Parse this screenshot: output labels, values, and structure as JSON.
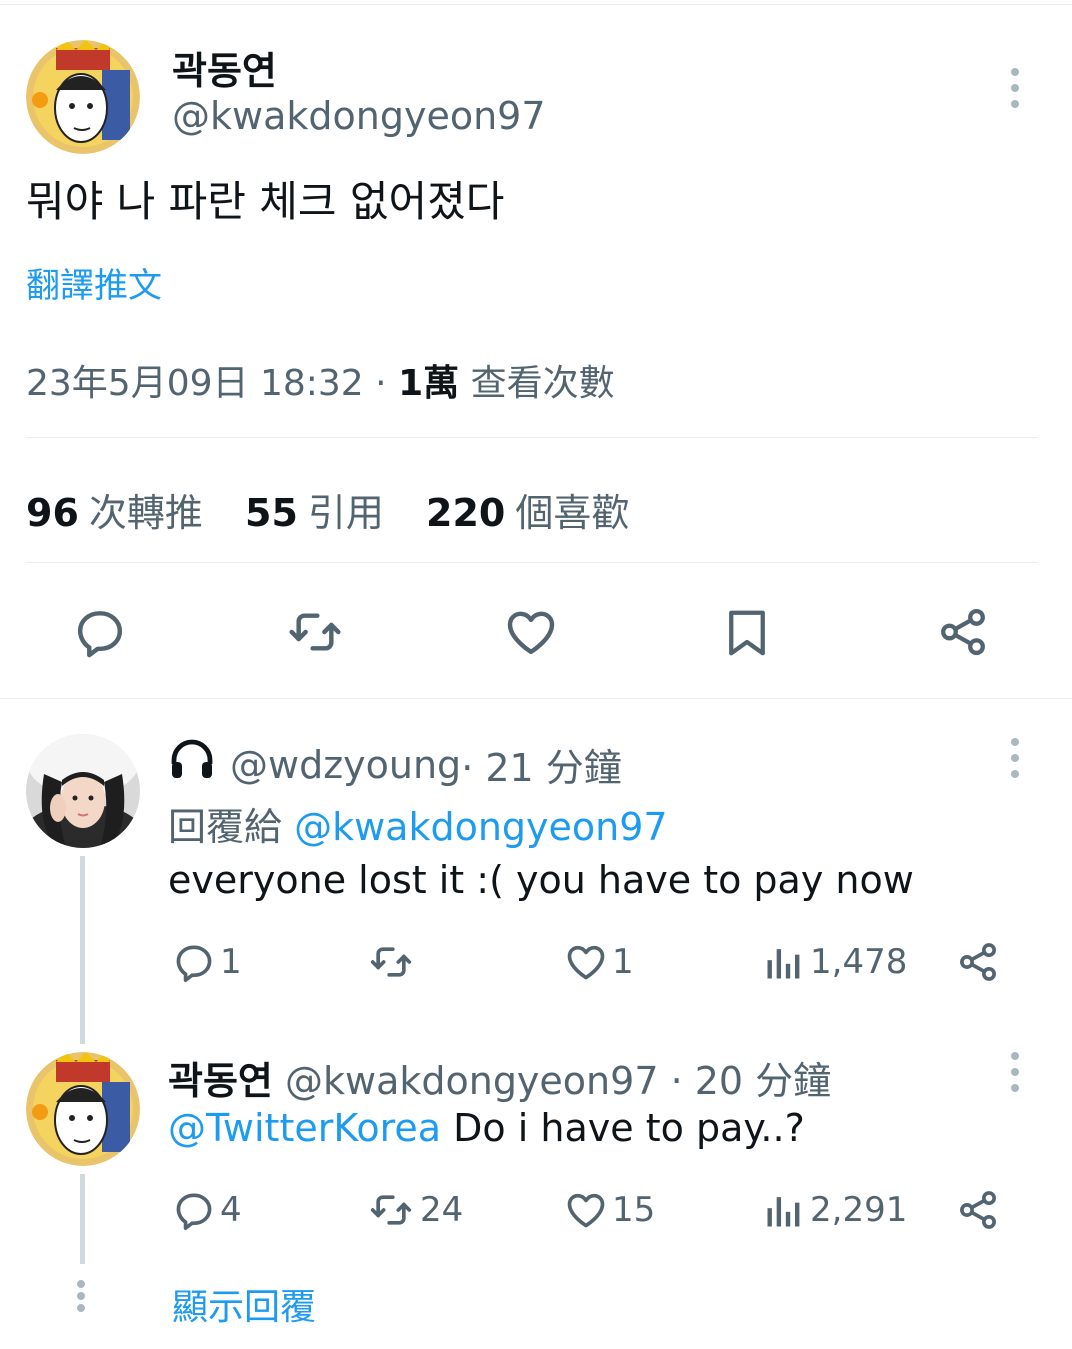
{
  "main_tweet": {
    "display_name": "곽동연",
    "handle": "@kwakdongyeon97",
    "text": "뭐야 나 파란 체크 없어졌다",
    "translate_label": "翻譯推文",
    "timestamp": "23年5月09日 18:32",
    "separator": " · ",
    "views_count": "1萬",
    "views_label": " 查看次數",
    "stats": {
      "retweets_count": "96",
      "retweets_label": "次轉推",
      "quotes_count": "55",
      "quotes_label": "引用",
      "likes_count": "220",
      "likes_label": "個喜歡"
    },
    "actions": [
      "reply-icon",
      "retweet-icon",
      "like-icon",
      "bookmark-icon",
      "share-icon"
    ]
  },
  "replies": [
    {
      "badge_icon": "headphones-icon",
      "handle": "@wdzyoung",
      "time": " · 21 分鐘",
      "replying_label": "回覆給 ",
      "replying_to": "@kwakdongyeon97",
      "text": "everyone lost it :( you have to pay now",
      "reply_count": "1",
      "retweet_count": "",
      "like_count": "1",
      "view_count": "1,478"
    },
    {
      "display_name": "곽동연",
      "handle": "@kwakdongyeon97",
      "time": " · 20 分鐘",
      "mention": "@TwitterKorea",
      "text": " Do i have to pay..?",
      "reply_count": "4",
      "retweet_count": "24",
      "like_count": "15",
      "view_count": "2,291"
    }
  ],
  "show_replies_label": "顯示回覆",
  "colors": {
    "accent": "#1d9bf0",
    "secondary_text": "#536471",
    "primary_text": "#0f1419"
  }
}
